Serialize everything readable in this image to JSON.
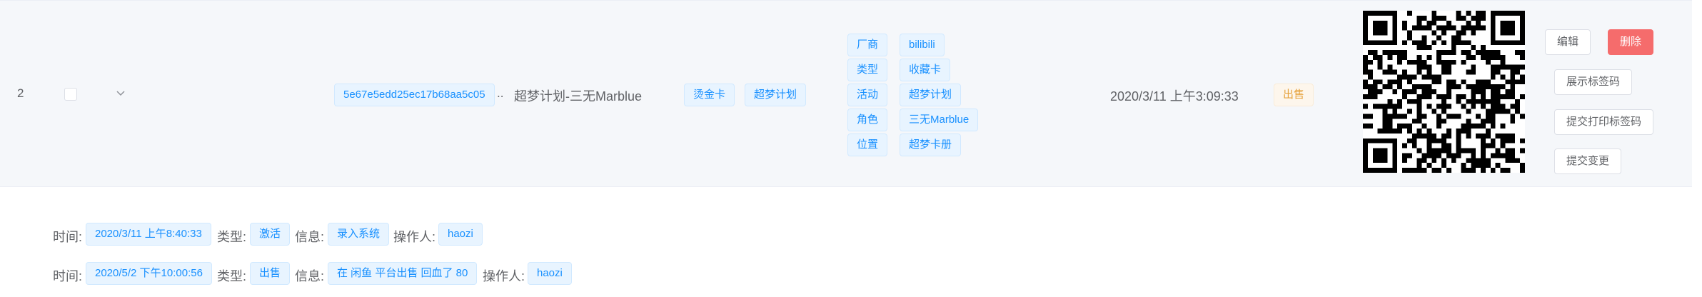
{
  "row": {
    "index": "2",
    "id_tag": "5e67e5edd25ec17b68aa5c05",
    "ellipsis": "..",
    "name": "超梦计划-三无Marblue",
    "tags": [
      "烫金卡",
      "超梦计划"
    ],
    "attributes": [
      {
        "key": "厂商",
        "value": "bilibili"
      },
      {
        "key": "类型",
        "value": "收藏卡"
      },
      {
        "key": "活动",
        "value": "超梦计划"
      },
      {
        "key": "角色",
        "value": "三无Marblue"
      },
      {
        "key": "位置",
        "value": "超梦卡册"
      }
    ],
    "created_at": "2020/3/11 上午3:09:33",
    "status": "出售",
    "actions": {
      "edit": "编辑",
      "delete": "删除",
      "show_label": "展示标签码",
      "submit_print": "提交打印标签码",
      "submit_change": "提交变更"
    }
  },
  "history_labels": {
    "time": "时间:",
    "type": "类型:",
    "info": "信息:",
    "operator": "操作人:"
  },
  "history": [
    {
      "time": "2020/3/11 上午8:40:33",
      "type": "激活",
      "info": "录入系统",
      "operator": "haozi"
    },
    {
      "time": "2020/5/2 下午10:00:56",
      "type": "出售",
      "info": "在 闲鱼 平台出售 回血了 80",
      "operator": "haozi"
    }
  ],
  "colors": {
    "row_bg": "#f5f7fa",
    "tag_text": "#1890ff",
    "tag_bg": "#e8f4ff",
    "danger": "#f56c6c",
    "warning": "#e6a23c"
  }
}
